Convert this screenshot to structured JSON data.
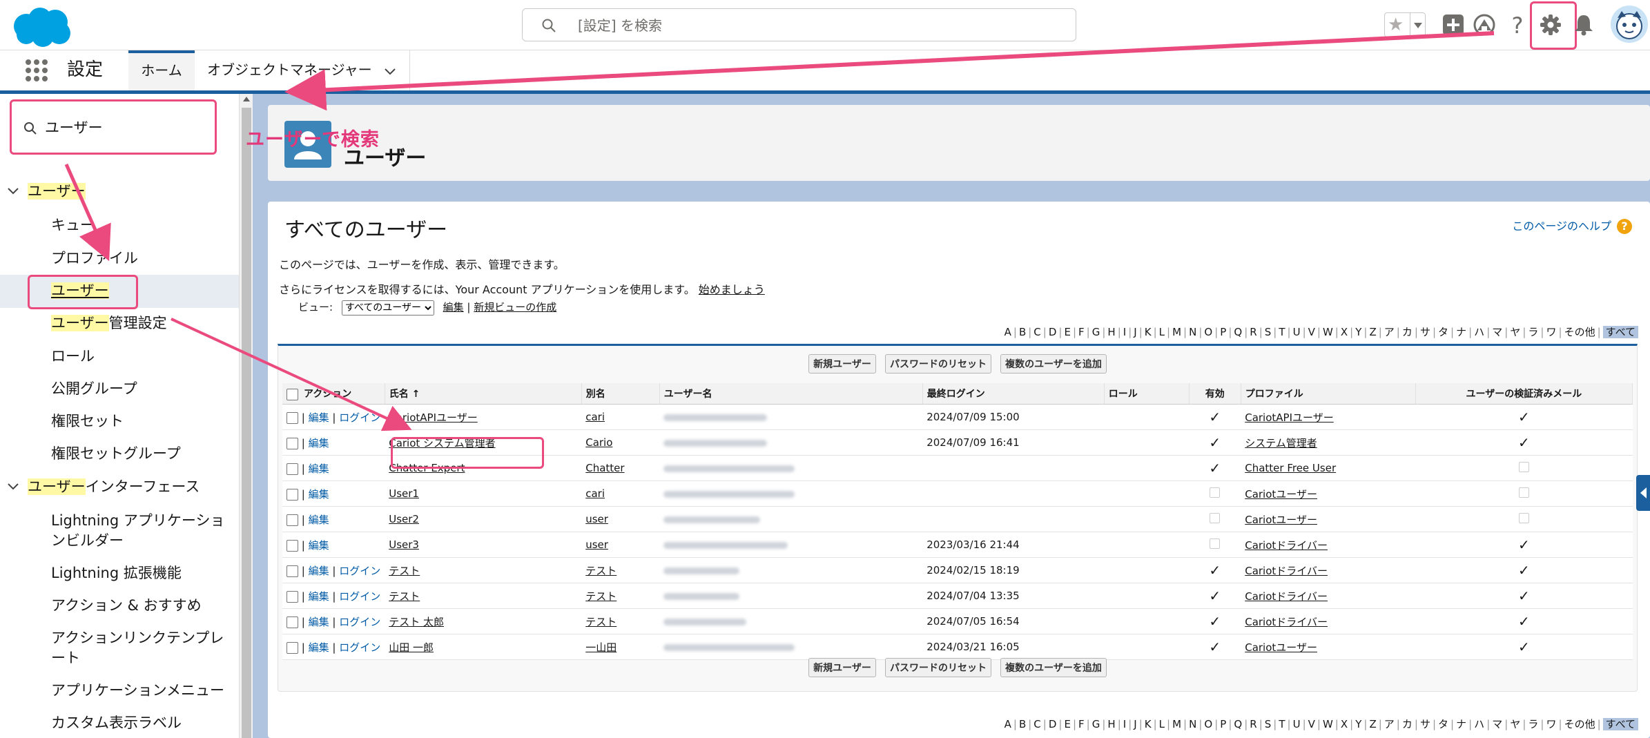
{
  "search": {
    "placeholder": "[設定] を検索"
  },
  "nav": {
    "app_name": "設定",
    "tab_home": "ホーム",
    "tab_object_manager": "オブジェクトマネージャー"
  },
  "quickfind": {
    "value": "ユーザー"
  },
  "sidebar": {
    "group1": {
      "mark": "ユーザー",
      "rest": ""
    },
    "items1": [
      "キュー",
      "プロファイル"
    ],
    "selected": {
      "mark": "ユーザー"
    },
    "item_mgmt": {
      "mark": "ユーザー",
      "rest": "管理設定"
    },
    "items2": [
      "ロール",
      "公開グループ",
      "権限セット",
      "権限セットグループ"
    ],
    "group2": {
      "mark": "ユーザー",
      "rest": "インターフェース"
    },
    "items3": [
      "Lightning アプリケーションビルダー",
      "Lightning 拡張機能",
      "アクション & おすすめ",
      "アクションリンクテンプレート",
      "アプリケーションメニュー",
      "カスタム表示ラベル"
    ]
  },
  "annotation": "ユーザーで検索",
  "header": {
    "title": "ユーザー"
  },
  "page": {
    "title": "すべてのユーザー",
    "help": "このページのヘルプ",
    "desc1": "このページでは、ユーザーを作成、表示、管理できます。",
    "desc2": "さらにライセンスを取得するには、Your Account アプリケーションを使用します。",
    "desc2_link": "始めましょう"
  },
  "view": {
    "label": "ビュー:",
    "selected": "すべてのユーザー",
    "edit": "編集",
    "new_view": "新規ビューの作成"
  },
  "alpha": [
    "A",
    "B",
    "C",
    "D",
    "E",
    "F",
    "G",
    "H",
    "I",
    "J",
    "K",
    "L",
    "M",
    "N",
    "O",
    "P",
    "Q",
    "R",
    "S",
    "T",
    "U",
    "V",
    "W",
    "X",
    "Y",
    "Z",
    "ア",
    "カ",
    "サ",
    "タ",
    "ナ",
    "ハ",
    "マ",
    "ヤ",
    "ラ",
    "ワ",
    "その他",
    "すべて"
  ],
  "buttons": {
    "new_user": "新規ユーザー",
    "reset_password": "パスワードのリセット",
    "add_multiple": "複数のユーザーを追加"
  },
  "table": {
    "headers": {
      "action": "アクション",
      "name": "氏名 ↑",
      "alias": "別名",
      "username": "ユーザー名",
      "last_login": "最終ログイン",
      "role": "ロール",
      "active": "有効",
      "profile": "プロファイル",
      "verified": "ユーザーの検証済みメール"
    },
    "edit": "編集",
    "login": "ログイン",
    "rows": [
      {
        "name": "CariotAPIユーザー",
        "alias": "cari",
        "last_login": "2024/07/09 15:00",
        "active": true,
        "profile": "CariotAPIユーザー",
        "verified": true,
        "login": true
      },
      {
        "name": "Cariot システム管理者",
        "alias": "Cario",
        "last_login": "2024/07/09 16:41",
        "active": true,
        "profile": "システム管理者",
        "verified": true,
        "login": false
      },
      {
        "name": "Chatter Expert",
        "alias": "Chatter",
        "last_login": "",
        "active": true,
        "profile": "Chatter Free User",
        "verified": false,
        "login": false
      },
      {
        "name": "User1",
        "alias": "cari",
        "last_login": "",
        "active": false,
        "profile": "Cariotユーザー",
        "verified": false,
        "login": false
      },
      {
        "name": "User2",
        "alias": "user",
        "last_login": "",
        "active": false,
        "profile": "Cariotユーザー",
        "verified": false,
        "login": false
      },
      {
        "name": "User3",
        "alias": "user",
        "last_login": "2023/03/16 21:44",
        "active": false,
        "profile": "Cariotドライバー",
        "verified": true,
        "login": false
      },
      {
        "name": "テスト",
        "alias": "テスト",
        "last_login": "2024/02/15 18:19",
        "active": true,
        "profile": "Cariotドライバー",
        "verified": true,
        "login": true
      },
      {
        "name": "テスト",
        "alias": "テスト",
        "last_login": "2024/07/04 13:35",
        "active": true,
        "profile": "Cariotドライバー",
        "verified": true,
        "login": true
      },
      {
        "name": "テスト 太郎",
        "alias": "テスト",
        "last_login": "2024/07/05 16:54",
        "active": true,
        "profile": "Cariotドライバー",
        "verified": true,
        "login": true
      },
      {
        "name": "山田 一郎",
        "alias": "一山田",
        "last_login": "2024/03/21 16:05",
        "active": true,
        "profile": "Cariotユーザー",
        "verified": true,
        "login": true
      }
    ]
  },
  "colors": {
    "accent": "#1b5f9e",
    "highlight": "#ea4a7d",
    "brand": "#00a1e0"
  }
}
